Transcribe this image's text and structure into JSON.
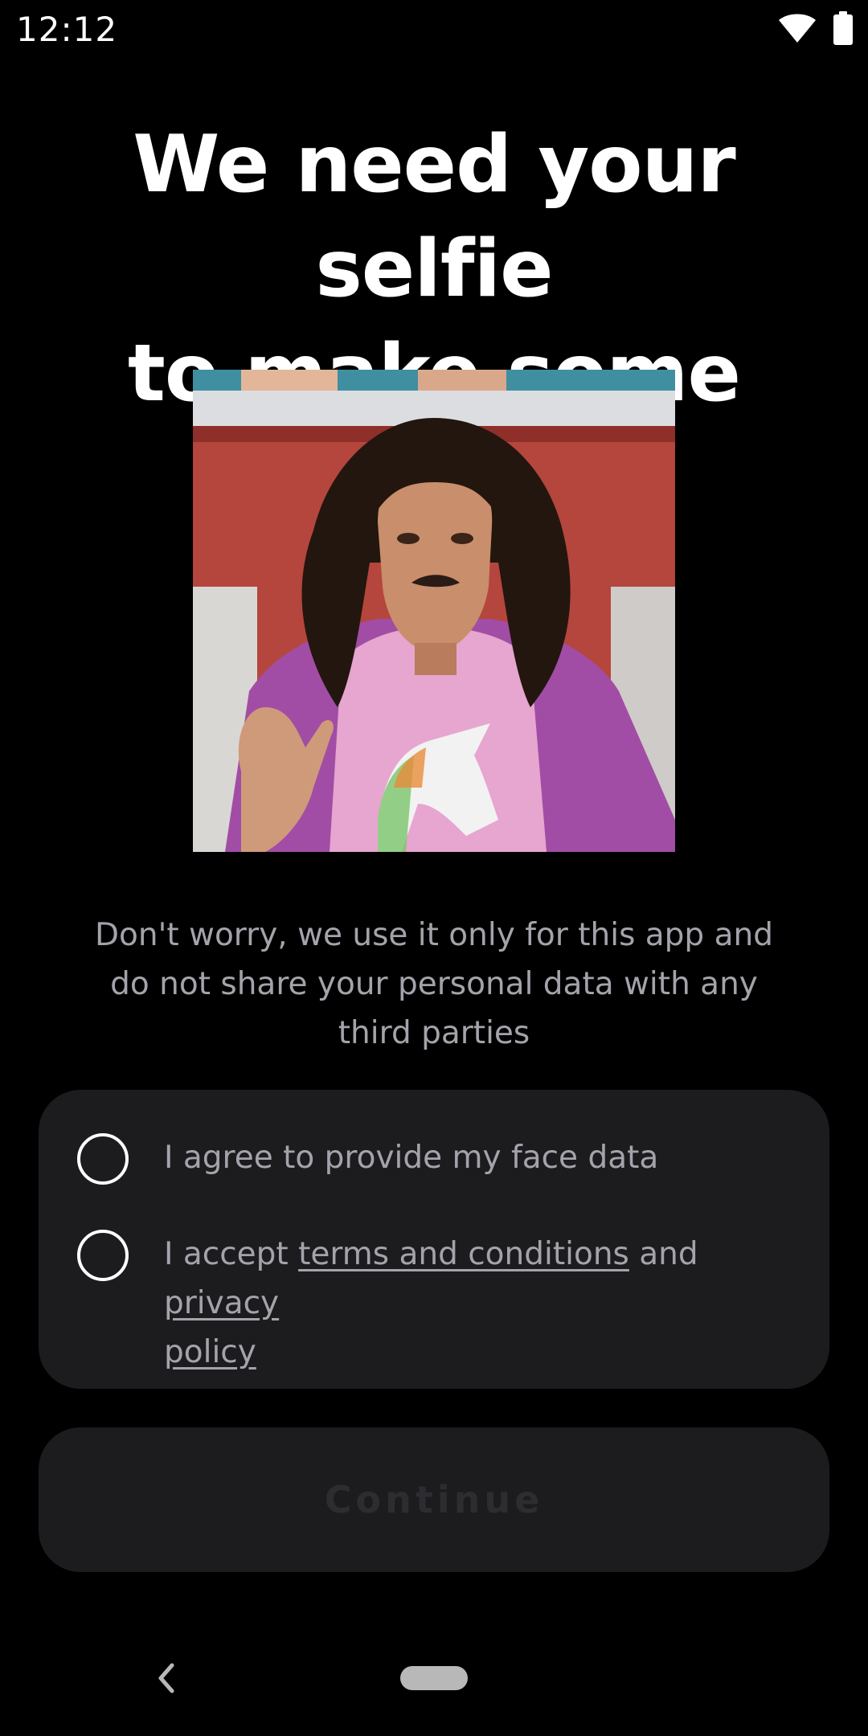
{
  "status_bar": {
    "time": "12:12",
    "wifi_icon": "wifi-icon",
    "battery_icon": "battery-icon"
  },
  "title": {
    "line1": "We need your selfie",
    "line2": "to make some"
  },
  "photo": {
    "icon": "selfie-example-photo"
  },
  "subtitle": {
    "line1": "Don't worry, we use it only for this app and",
    "line2": "do not share your personal data with any",
    "line3": "third parties"
  },
  "consent": {
    "face_data_label": "I agree to provide my face data",
    "terms_prefix": "I accept ",
    "terms_link": "terms and conditions",
    "terms_middle": " and ",
    "privacy_link_part1": "privacy",
    "privacy_link_part2": "policy"
  },
  "continue_button": {
    "label": "Continue"
  },
  "nav_bar": {
    "back_icon": "back-chevron-icon",
    "home_icon": "home-pill-icon"
  },
  "colors": {
    "background": "#000000",
    "card": "#1c1c1f",
    "muted_text": "#a3a3ab",
    "disabled_text": "#2d2d31"
  }
}
